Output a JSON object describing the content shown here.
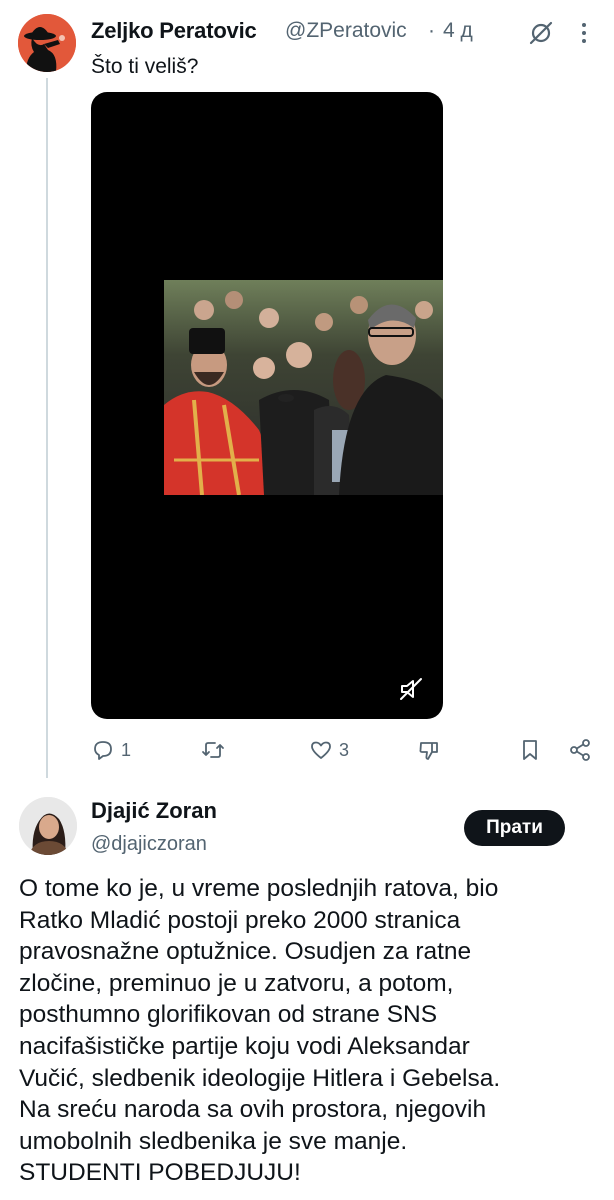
{
  "tweet1": {
    "author_name": "Zeljko Peratovic",
    "handle": "@ZPeratovic",
    "separator": "·",
    "time": "4 д",
    "text": "Što ti veliš?",
    "actions": {
      "replies": "1",
      "reposts": "",
      "likes": "3"
    }
  },
  "tweet2": {
    "author_name": "Djajić Zoran",
    "handle": "@djajiczoran",
    "follow_label": "Прати",
    "text_lines": [
      "O tome ko je, u vreme poslednjih ratova, bio",
      "Ratko Mladić postoji preko 2000 stranica",
      "pravosnažne optužnice. Osudjen za ratne",
      "zločine, preminuo je u zatvoru, a potom,",
      "posthumno glorifikovan od strane SNS",
      "nacifašističke partije koju vodi Aleksandar",
      "Vučić, sledbenik ideologije Hitlera i Gebelsa.",
      "Na sreću naroda sa ovih prostora, njegovih",
      "umobolnih sledbenika je sve manje.",
      "STUDENTI POBEDJUJU!"
    ]
  },
  "colors": {
    "avatar1_bg": "#e2583a",
    "muted_text": "#536471",
    "follow_button": "#0f1419"
  }
}
